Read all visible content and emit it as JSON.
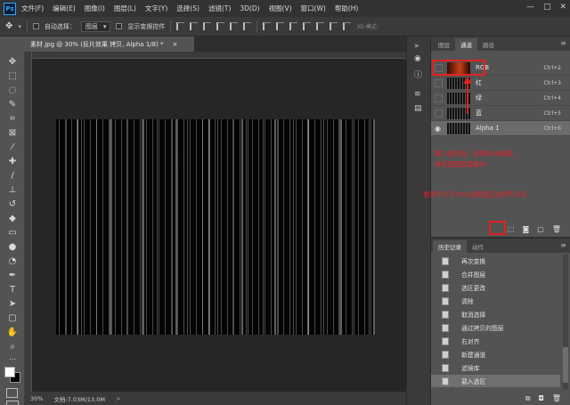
{
  "app": {
    "logo": "Ps"
  },
  "menu": [
    "文件(F)",
    "编辑(E)",
    "图像(I)",
    "图层(L)",
    "文字(Y)",
    "选择(S)",
    "滤镜(T)",
    "3D(D)",
    "视图(V)",
    "窗口(W)",
    "帮助(H)"
  ],
  "window_controls": [
    "—",
    "□",
    "✕"
  ],
  "options": {
    "auto_select_label": "自动选择：",
    "auto_select_value": "图层",
    "show_transform_label": "显示变换控件",
    "mode_3d": "3D 模式："
  },
  "document": {
    "tab_title": "素材.jpg @ 30% (反片效果 拷贝, Alpha 1/8) *",
    "tab_close": "×"
  },
  "status": {
    "zoom": "30%",
    "doc_info": "文档:7.03M/13.0M",
    "arrow": ">"
  },
  "panels": {
    "channels_tabs": [
      "图层",
      "通道",
      "路径"
    ],
    "channels_active": 1,
    "channels": [
      {
        "name": "RGB",
        "key": "Ctrl+2",
        "visible": false,
        "selected": false
      },
      {
        "name": "红",
        "key": "Ctrl+3",
        "visible": false,
        "selected": false
      },
      {
        "name": "绿",
        "key": "Ctrl+4",
        "visible": false,
        "selected": false
      },
      {
        "name": "蓝",
        "key": "Ctrl+5",
        "visible": false,
        "selected": false
      },
      {
        "name": "Alpha 1",
        "key": "Ctrl+6",
        "visible": true,
        "selected": true
      }
    ],
    "notes": {
      "note1_line1": "载入选区后，选择RGB通道，",
      "note1_line2": "再返回图层面板中",
      "note2": "像素不大于50%选择选区边将不可见"
    },
    "history_tabs": [
      "历史记录",
      "动作"
    ],
    "history": [
      {
        "label": "再次变换",
        "selected": false
      },
      {
        "label": "合并图层",
        "selected": false
      },
      {
        "label": "选区更改",
        "selected": false
      },
      {
        "label": "清除",
        "selected": false
      },
      {
        "label": "取消选择",
        "selected": false
      },
      {
        "label": "通过拷贝的图层",
        "selected": false
      },
      {
        "label": "右对齐",
        "selected": false
      },
      {
        "label": "新建通道",
        "selected": false
      },
      {
        "label": "滤镜库",
        "selected": false
      },
      {
        "label": "载入选区",
        "selected": true
      }
    ]
  },
  "colors": {
    "accent_red": "#e42020",
    "foreground": "#ffffff",
    "background": "#000000"
  }
}
